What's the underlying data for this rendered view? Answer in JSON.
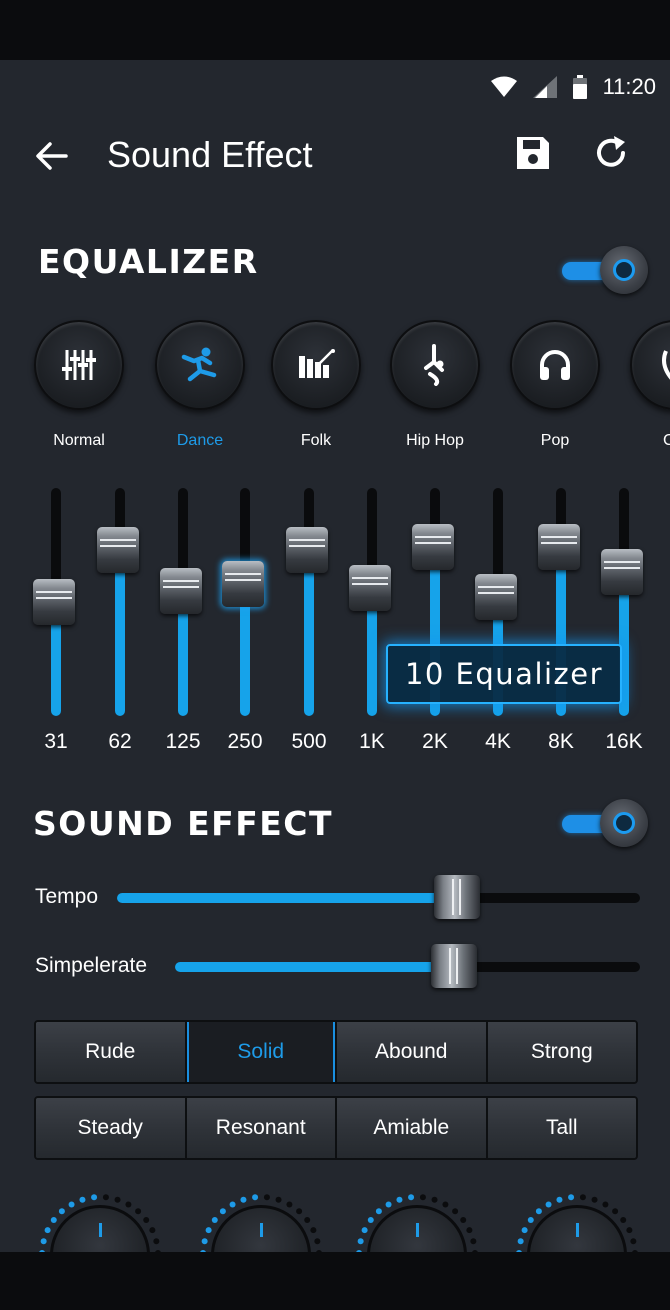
{
  "status_bar": {
    "time": "11:20"
  },
  "header": {
    "title": "Sound Effect"
  },
  "equalizer": {
    "title": "EQUALIZER",
    "enabled": true,
    "presets": [
      {
        "label": "Normal",
        "icon": "sliders-icon",
        "active": false
      },
      {
        "label": "Dance",
        "icon": "dancer-icon",
        "active": true
      },
      {
        "label": "Folk",
        "icon": "xylophone-icon",
        "active": false
      },
      {
        "label": "Hip Hop",
        "icon": "breakdancer-icon",
        "active": false
      },
      {
        "label": "Pop",
        "icon": "headphones-icon",
        "active": false
      },
      {
        "label": "Cla",
        "icon": "lyre-icon",
        "active": false
      }
    ],
    "bands": [
      {
        "freq": "31",
        "level": 0.5
      },
      {
        "freq": "62",
        "level": 0.73
      },
      {
        "freq": "125",
        "level": 0.55
      },
      {
        "freq": "250",
        "level": 0.58
      },
      {
        "freq": "500",
        "level": 0.73
      },
      {
        "freq": "1K",
        "level": 0.56
      },
      {
        "freq": "2K",
        "level": 0.74
      },
      {
        "freq": "4K",
        "level": 0.52
      },
      {
        "freq": "8K",
        "level": 0.74
      },
      {
        "freq": "16K",
        "level": 0.63
      }
    ],
    "badge": "10 Equalizer"
  },
  "sound_effect": {
    "title": "SOUND EFFECT",
    "enabled": true,
    "sliders": [
      {
        "label": "Tempo",
        "level": 0.65
      },
      {
        "label": "Simpelerate",
        "level": 0.6
      }
    ],
    "modes_row1": [
      {
        "label": "Rude",
        "active": false
      },
      {
        "label": "Solid",
        "active": true
      },
      {
        "label": "Abound",
        "active": false
      },
      {
        "label": "Strong",
        "active": false
      }
    ],
    "modes_row2": [
      {
        "label": "Steady",
        "active": false
      },
      {
        "label": "Resonant",
        "active": false
      },
      {
        "label": "Amiable",
        "active": false
      },
      {
        "label": "Tall",
        "active": false
      }
    ]
  },
  "colors": {
    "accent": "#1e9be8",
    "background": "#23272e"
  }
}
